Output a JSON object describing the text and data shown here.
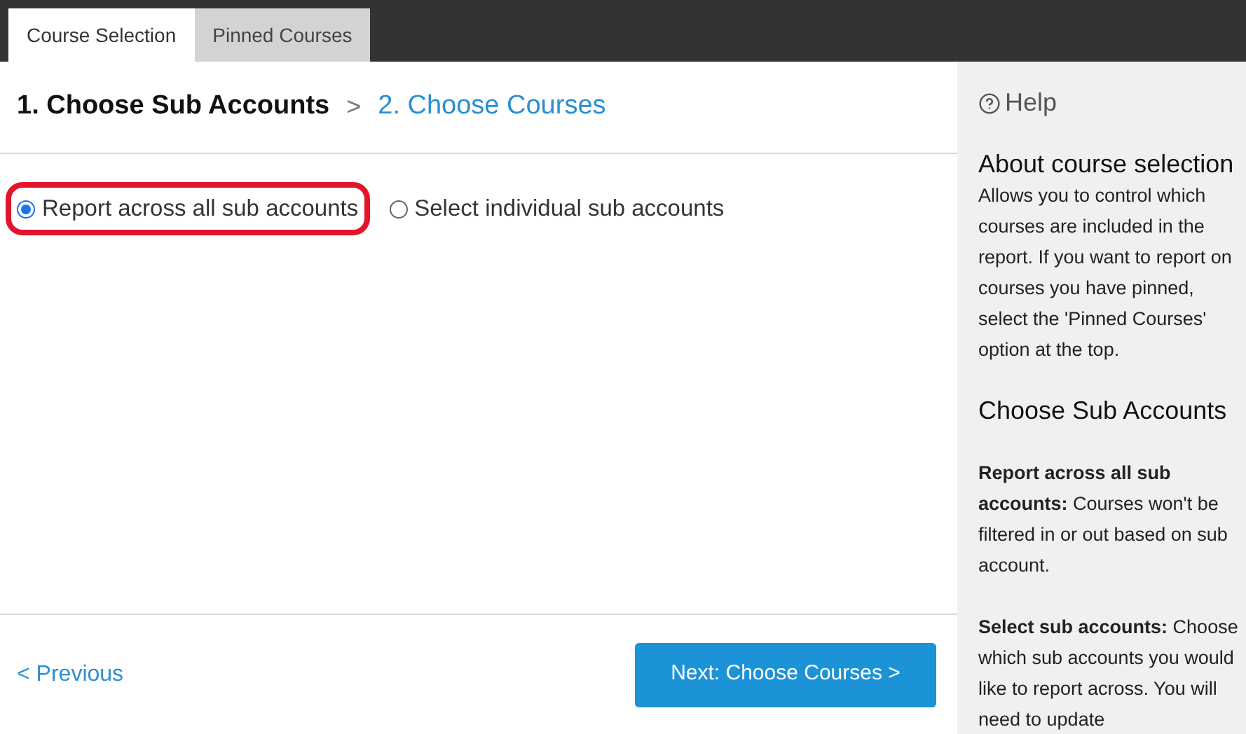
{
  "tabs": [
    {
      "label": "Course Selection",
      "selected": true
    },
    {
      "label": "Pinned Courses",
      "selected": false
    }
  ],
  "steps": {
    "items": [
      {
        "label": "1. Choose Sub Accounts",
        "selected": true
      },
      {
        "label": "2. Choose Courses",
        "selected": false
      }
    ],
    "separator": ">"
  },
  "options": [
    {
      "label": "Report across all sub accounts",
      "selected": true,
      "highlighted": true
    },
    {
      "label": "Select individual sub accounts",
      "selected": false,
      "highlighted": false
    }
  ],
  "footer": {
    "previous": "< Previous",
    "next": "Next: Choose Courses >"
  },
  "help": {
    "title": "Help",
    "sections": [
      {
        "heading": "About course selection",
        "paragraphs": [
          "Allows you to control which courses are included in the report. If you want to report on courses you have pinned, select the 'Pinned Courses' option at the top."
        ]
      },
      {
        "heading": "Choose Sub Accounts",
        "paragraphs": [
          "**Report across all sub accounts:** Courses won't be filtered in or out based on sub account.",
          "**Select sub accounts:** Choose which sub accounts you would like to report across. You will need to update"
        ]
      }
    ]
  }
}
